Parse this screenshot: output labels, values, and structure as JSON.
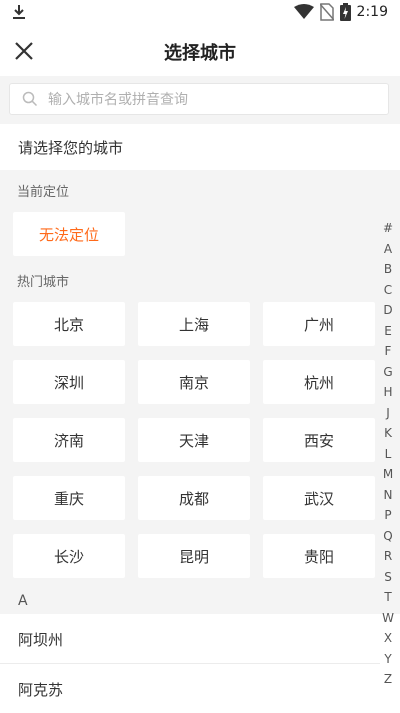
{
  "status_bar": {
    "time": "2:19",
    "icons": [
      "download-icon",
      "wifi-icon",
      "no-sim-icon",
      "battery-charging-icon"
    ]
  },
  "nav": {
    "title": "选择城市",
    "close_icon": "close-icon"
  },
  "search": {
    "placeholder": "输入城市名或拼音查询",
    "value": ""
  },
  "prompt": "请选择您的城市",
  "current_location": {
    "label": "当前定位",
    "button": "无法定位",
    "button_color": "#ff6a1a"
  },
  "hot_cities": {
    "label": "热门城市",
    "cities": [
      "北京",
      "上海",
      "广州",
      "深圳",
      "南京",
      "杭州",
      "济南",
      "天津",
      "西安",
      "重庆",
      "成都",
      "武汉",
      "长沙",
      "昆明",
      "贵阳"
    ]
  },
  "city_list": {
    "letter": "A",
    "items": [
      "阿坝州",
      "阿克苏"
    ]
  },
  "index_letters": [
    "#",
    "A",
    "B",
    "C",
    "D",
    "E",
    "F",
    "G",
    "H",
    "J",
    "K",
    "L",
    "M",
    "N",
    "P",
    "Q",
    "R",
    "S",
    "T",
    "W",
    "X",
    "Y",
    "Z"
  ]
}
